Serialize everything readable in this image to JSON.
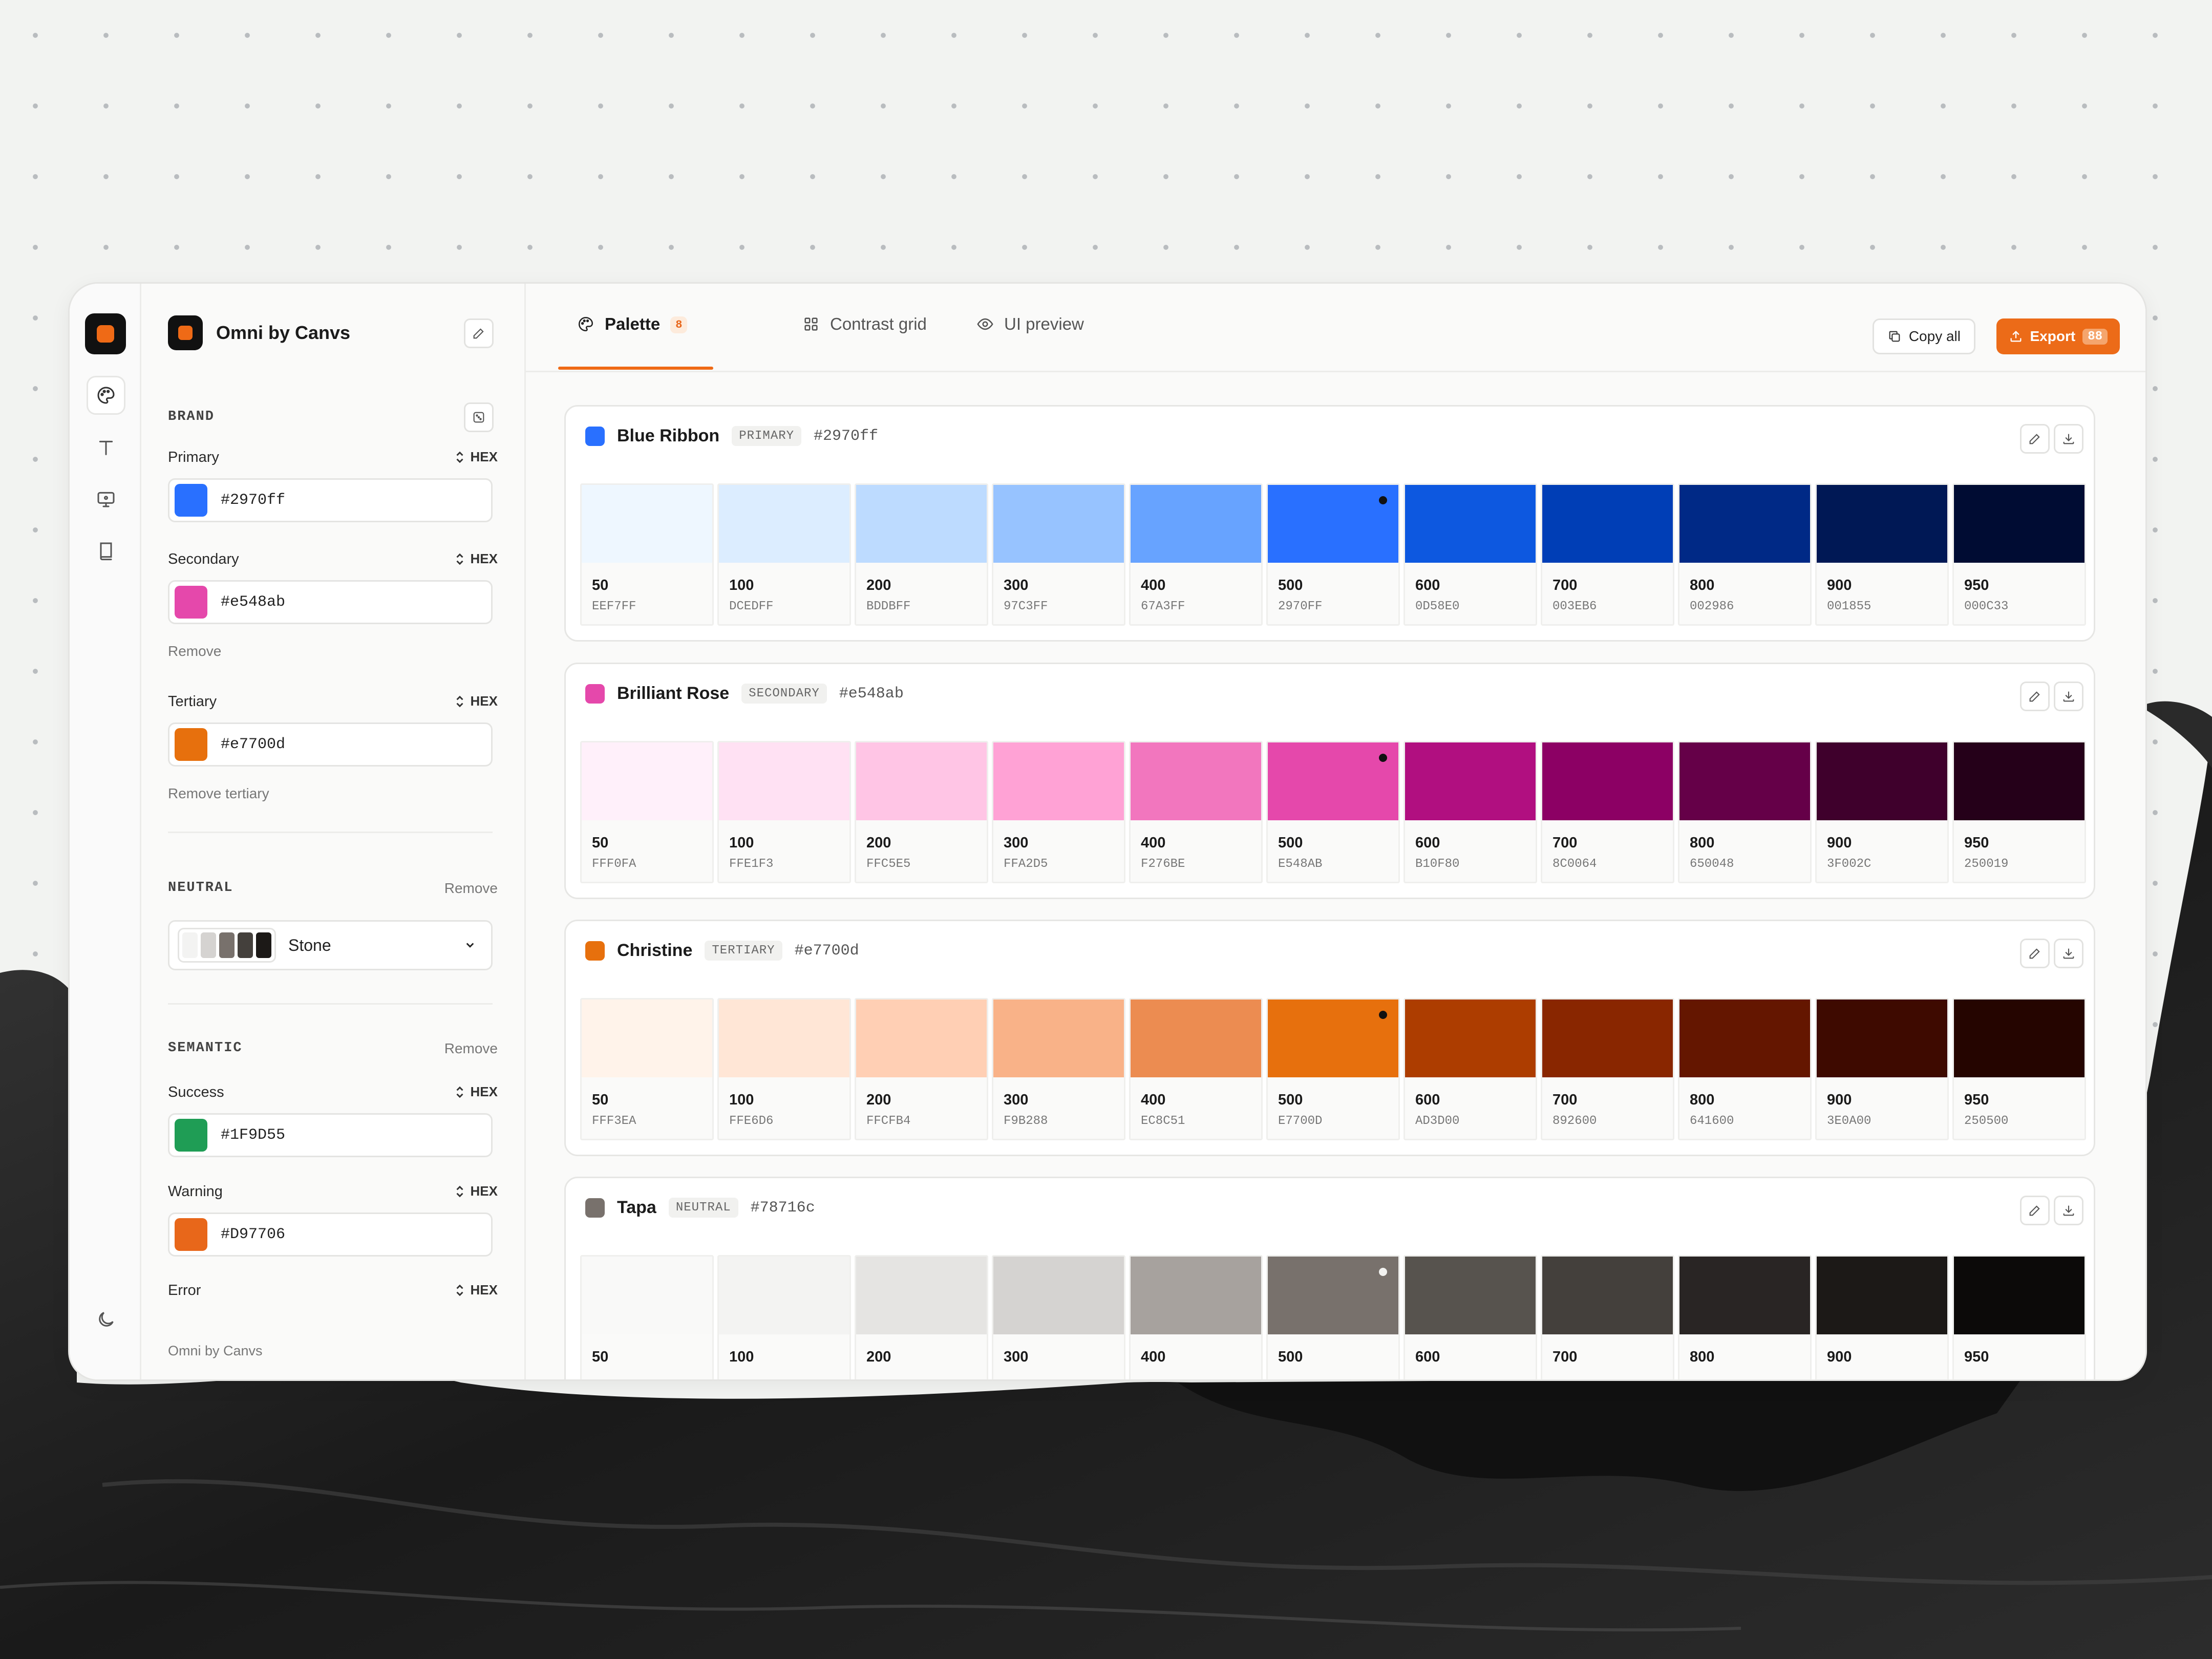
{
  "app": {
    "name": "Omni by Canvs"
  },
  "tabs": [
    {
      "label": "Palette",
      "count": "8"
    },
    {
      "label": "Contrast grid"
    },
    {
      "label": "UI preview"
    }
  ],
  "toolbar": {
    "copy_label": "Copy all",
    "export_label": "Export",
    "export_count": "88"
  },
  "sidebar": {
    "brand_heading": "BRAND",
    "primary": {
      "label": "Primary",
      "mode": "HEX",
      "value": "#2970ff",
      "color": "#2970ff"
    },
    "secondary": {
      "label": "Secondary",
      "mode": "HEX",
      "value": "#e548ab",
      "color": "#e548ab",
      "remove": "Remove"
    },
    "tertiary": {
      "label": "Tertiary",
      "mode": "HEX",
      "value": "#e7700d",
      "color": "#e7700d",
      "remove": "Remove tertiary"
    },
    "neutral_heading": "NEUTRAL",
    "neutral_remove": "Remove",
    "neutral_value": "Stone",
    "semantic_heading": "SEMANTIC",
    "semantic_remove": "Remove",
    "success": {
      "label": "Success",
      "mode": "HEX",
      "value": "#1F9D55",
      "color": "#1f9d55"
    },
    "warning": {
      "label": "Warning",
      "mode": "HEX",
      "value": "#D97706",
      "color": "#e8671a"
    },
    "error": {
      "label": "Error",
      "mode": "HEX"
    },
    "footer": "Omni by Canvs"
  },
  "palettes": [
    {
      "name": "Blue Ribbon",
      "role": "PRIMARY",
      "hex": "#2970ff",
      "color": "#2970ff",
      "base_index": 5,
      "shades": [
        {
          "step": "50",
          "code": "EEF7FF",
          "color": "#eef7ff"
        },
        {
          "step": "100",
          "code": "DCEDFF",
          "color": "#dcedff"
        },
        {
          "step": "200",
          "code": "BDDBFF",
          "color": "#bddbff"
        },
        {
          "step": "300",
          "code": "97C3FF",
          "color": "#97c3ff"
        },
        {
          "step": "400",
          "code": "67A3FF",
          "color": "#67a3ff"
        },
        {
          "step": "500",
          "code": "2970FF",
          "color": "#2970ff"
        },
        {
          "step": "600",
          "code": "0D58E0",
          "color": "#0d58e0"
        },
        {
          "step": "700",
          "code": "003EB6",
          "color": "#003eb6"
        },
        {
          "step": "800",
          "code": "002986",
          "color": "#002986"
        },
        {
          "step": "900",
          "code": "001855",
          "color": "#001855"
        },
        {
          "step": "950",
          "code": "000C33",
          "color": "#000c33"
        }
      ]
    },
    {
      "name": "Brilliant Rose",
      "role": "SECONDARY",
      "hex": "#e548ab",
      "color": "#e548ab",
      "base_index": 5,
      "shades": [
        {
          "step": "50",
          "code": "FFF0FA",
          "color": "#fff0fa"
        },
        {
          "step": "100",
          "code": "FFE1F3",
          "color": "#ffe1f3"
        },
        {
          "step": "200",
          "code": "FFC5E5",
          "color": "#ffc5e5"
        },
        {
          "step": "300",
          "code": "FFA2D5",
          "color": "#ffa2d5"
        },
        {
          "step": "400",
          "code": "F276BE",
          "color": "#f276be"
        },
        {
          "step": "500",
          "code": "E548AB",
          "color": "#e548ab"
        },
        {
          "step": "600",
          "code": "B10F80",
          "color": "#b10f80"
        },
        {
          "step": "700",
          "code": "8C0064",
          "color": "#8c0064"
        },
        {
          "step": "800",
          "code": "650048",
          "color": "#650048"
        },
        {
          "step": "900",
          "code": "3F002C",
          "color": "#3f002c"
        },
        {
          "step": "950",
          "code": "250019",
          "color": "#250019"
        }
      ]
    },
    {
      "name": "Christine",
      "role": "TERTIARY",
      "hex": "#e7700d",
      "color": "#e7700d",
      "base_index": 5,
      "shades": [
        {
          "step": "50",
          "code": "FFF3EA",
          "color": "#fff3ea"
        },
        {
          "step": "100",
          "code": "FFE6D6",
          "color": "#ffe6d6"
        },
        {
          "step": "200",
          "code": "FFCFB4",
          "color": "#ffcfb4"
        },
        {
          "step": "300",
          "code": "F9B288",
          "color": "#f9b288"
        },
        {
          "step": "400",
          "code": "EC8C51",
          "color": "#ec8c51"
        },
        {
          "step": "500",
          "code": "E7700D",
          "color": "#e7700d"
        },
        {
          "step": "600",
          "code": "AD3D00",
          "color": "#ad3d00"
        },
        {
          "step": "700",
          "code": "892600",
          "color": "#892600"
        },
        {
          "step": "800",
          "code": "641600",
          "color": "#641600"
        },
        {
          "step": "900",
          "code": "3E0A00",
          "color": "#3e0a00"
        },
        {
          "step": "950",
          "code": "250500",
          "color": "#250500"
        }
      ]
    },
    {
      "name": "Tapa",
      "role": "NEUTRAL",
      "hex": "#78716c",
      "color": "#78716c",
      "base_index": 5,
      "shades": [
        {
          "step": "50",
          "code": "",
          "color": "#f9f9f8"
        },
        {
          "step": "100",
          "code": "",
          "color": "#f3f3f2"
        },
        {
          "step": "200",
          "code": "",
          "color": "#e5e4e2"
        },
        {
          "step": "300",
          "code": "",
          "color": "#d5d3d1"
        },
        {
          "step": "400",
          "code": "",
          "color": "#a7a29e"
        },
        {
          "step": "500",
          "code": "",
          "color": "#78716c"
        },
        {
          "step": "600",
          "code": "",
          "color": "#57534e"
        },
        {
          "step": "700",
          "code": "",
          "color": "#44403c"
        },
        {
          "step": "800",
          "code": "",
          "color": "#292524"
        },
        {
          "step": "900",
          "code": "",
          "color": "#1c1917"
        },
        {
          "step": "950",
          "code": "",
          "color": "#0c0a09"
        }
      ]
    }
  ],
  "neutral_strip": [
    "#f3f3f2",
    "#d5d3d1",
    "#78716c",
    "#44403c",
    "#1c1917"
  ]
}
